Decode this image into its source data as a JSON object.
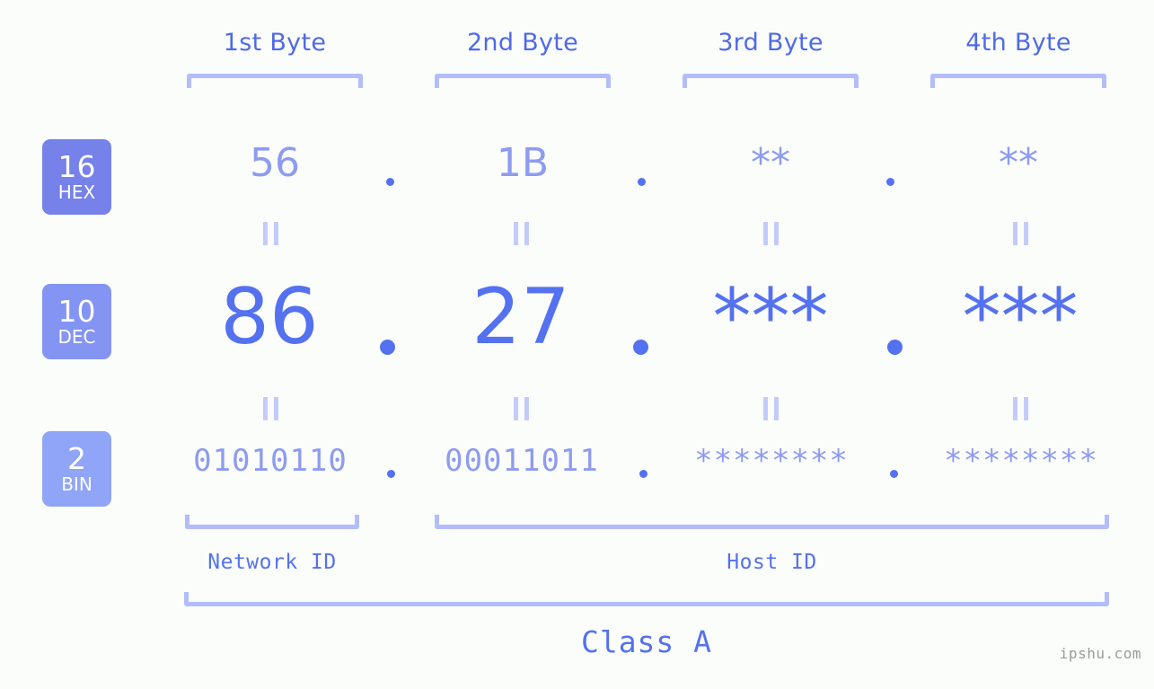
{
  "background_color": "#fbfdfa",
  "accent_colors": {
    "strong_blue": "#5471f0",
    "header_blue": "#4f6ae8",
    "light_blue": "#8d9bf0",
    "bracket_blue": "#b3bdfb",
    "eq_blue": "#c3cbfb",
    "badge_hex": "#7681ea",
    "badge_dec": "#8494f3",
    "badge_bin": "#90a5f7",
    "watermark_gray": "#9a9a9a"
  },
  "byte_headers": [
    {
      "label": "1st Byte"
    },
    {
      "label": "2nd Byte"
    },
    {
      "label": "3rd Byte"
    },
    {
      "label": "4th Byte"
    }
  ],
  "bases": [
    {
      "number": "16",
      "name": "HEX"
    },
    {
      "number": "10",
      "name": "DEC"
    },
    {
      "number": "2",
      "name": "BIN"
    }
  ],
  "rows": {
    "hex": {
      "base_number": "16",
      "base_name": "HEX",
      "values": [
        "56",
        "1B",
        "**",
        "**"
      ],
      "separator": "."
    },
    "dec": {
      "base_number": "10",
      "base_name": "DEC",
      "values": [
        "86",
        "27",
        "***",
        "***"
      ],
      "separator": "."
    },
    "bin": {
      "base_number": "2",
      "base_name": "BIN",
      "values": [
        "01010110",
        "00011011",
        "********",
        "********"
      ],
      "separator": "."
    }
  },
  "equality_symbol": "=",
  "regions": [
    {
      "label": "Network ID"
    },
    {
      "label": "Host ID"
    }
  ],
  "class": {
    "label": "Class A"
  },
  "watermark": {
    "text": "ipshu.com"
  }
}
